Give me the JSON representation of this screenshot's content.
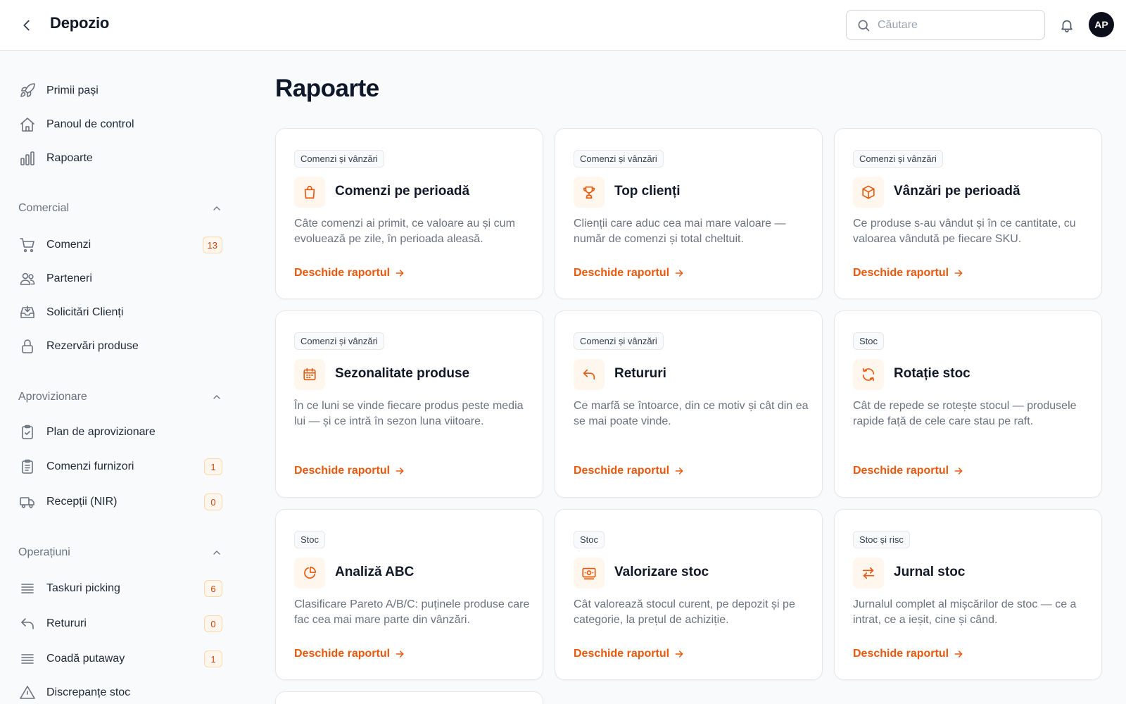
{
  "app": {
    "title": "Depozio",
    "avatar_initials": "AP"
  },
  "search": {
    "placeholder": "Căutare",
    "value": ""
  },
  "sidebar": {
    "top_items": [
      {
        "label": "Primii pași",
        "icon": "rocket-icon"
      },
      {
        "label": "Panoul de control",
        "icon": "home-icon"
      },
      {
        "label": "Rapoarte",
        "icon": "bar-chart-icon"
      }
    ],
    "sections": [
      {
        "title": "Comercial",
        "items": [
          {
            "label": "Comenzi",
            "icon": "cart-icon",
            "badge": "13"
          },
          {
            "label": "Parteneri",
            "icon": "users-icon",
            "badge": null
          },
          {
            "label": "Solicitări Clienți",
            "icon": "inbox-icon",
            "badge": null
          },
          {
            "label": "Rezervări produse",
            "icon": "lock-icon",
            "badge": null
          }
        ]
      },
      {
        "title": "Aprovizionare",
        "items": [
          {
            "label": "Plan de aprovizionare",
            "icon": "clipboard-check-icon",
            "badge": null
          },
          {
            "label": "Comenzi furnizori",
            "icon": "clipboard-list-icon",
            "badge": "1"
          },
          {
            "label": "Recepții (NIR)",
            "icon": "truck-icon",
            "badge": "0"
          }
        ]
      },
      {
        "title": "Operațiuni",
        "items": [
          {
            "label": "Taskuri picking",
            "icon": "list-icon",
            "badge": "6"
          },
          {
            "label": "Retururi",
            "icon": "undo-icon",
            "badge": "0"
          },
          {
            "label": "Coadă putaway",
            "icon": "list-icon",
            "badge": "1"
          },
          {
            "label": "Discrepanțe stoc",
            "icon": "warning-icon",
            "badge": null
          }
        ]
      }
    ]
  },
  "main": {
    "title": "Rapoarte",
    "link_label": "Deschide raportul",
    "cards": [
      {
        "tag": "Comenzi și vânzări",
        "title": "Comenzi pe perioadă",
        "icon": "shopping-bag-icon",
        "desc": "Câte comenzi ai primit, ce valoare au și cum evoluează pe zile, în perioada aleasă."
      },
      {
        "tag": "Comenzi și vânzări",
        "title": "Top clienți",
        "icon": "trophy-icon",
        "desc": "Clienții care aduc cea mai mare valoare — număr de comenzi și total cheltuit."
      },
      {
        "tag": "Comenzi și vânzări",
        "title": "Vânzări pe perioadă",
        "icon": "box-icon",
        "desc": "Ce produse s-au vândut și în ce cantitate, cu valoarea vândută pe fiecare SKU."
      },
      {
        "tag": "Comenzi și vânzări",
        "title": "Sezonalitate produse",
        "icon": "calendar-icon",
        "desc": "În ce luni se vinde fiecare produs peste media lui — și ce intră în sezon luna viitoare."
      },
      {
        "tag": "Comenzi și vânzări",
        "title": "Retururi",
        "icon": "undo-icon",
        "desc": "Ce marfă se întoarce, din ce motiv și cât din ea se mai poate vinde."
      },
      {
        "tag": "Stoc",
        "title": "Rotație stoc",
        "icon": "refresh-icon",
        "desc": "Cât de repede se rotește stocul — produsele rapide față de cele care stau pe raft."
      },
      {
        "tag": "Stoc",
        "title": "Analiză ABC",
        "icon": "pie-chart-icon",
        "desc": "Clasificare Pareto A/B/C: puținele produse care fac cea mai mare parte din vânzări."
      },
      {
        "tag": "Stoc",
        "title": "Valorizare stoc",
        "icon": "banknote-icon",
        "desc": "Cât valorează stocul curent, pe depozit și pe categorie, la prețul de achiziție."
      },
      {
        "tag": "Stoc și risc",
        "title": "Jurnal stoc",
        "icon": "swap-icon",
        "desc": "Jurnalul complet al mișcărilor de stoc — ce a intrat, ce a ieșit, cine și când."
      }
    ]
  },
  "colors": {
    "accent": "#ea580c",
    "icon_bg": "#fff7ed",
    "sidebar_icon": "#6b7280"
  }
}
